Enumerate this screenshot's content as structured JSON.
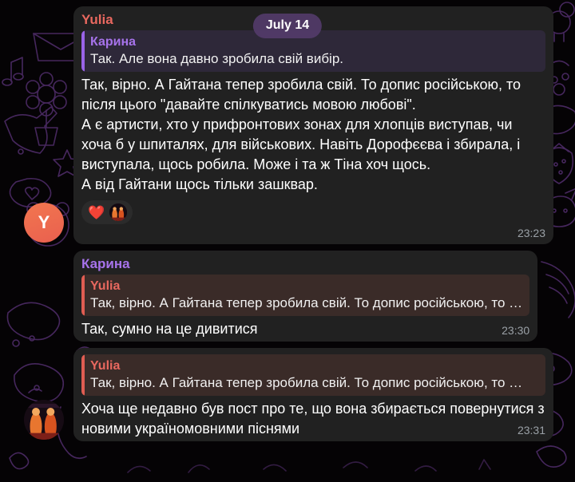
{
  "wallpaper": {
    "base_color": "#050305",
    "doodle_color": "#4a2a63"
  },
  "date_divider": {
    "label": "July 14"
  },
  "colors": {
    "bubble_bg": "#212121",
    "quote_purple_bg": "#2e2839",
    "quote_purple_bar": "#9a63e8",
    "quote_red_bg": "#3a2b28",
    "quote_red_bar": "#e05d52",
    "sender_red": "#e8685f",
    "sender_purple": "#a773eb",
    "time_gray": "#9aa0a6",
    "avatar_yulia": "#ef6a4f"
  },
  "messages": [
    {
      "id": "msg-1",
      "sender": "Yulia",
      "sender_color_class": "red",
      "avatar": {
        "type": "letter",
        "letter": "Y",
        "name": "avatar-yulia"
      },
      "quote": {
        "author": "Карина",
        "text": "Так. Але вона давно зробила свій вибір.",
        "style": "purple"
      },
      "body": "Так, вірно. А Гайтана тепер зробила свій. То допис російською, то після цього \"давайте спілкуватись мовою любові\".\nА є артисти, хто у прифронтових зонах для хлопців виступав, чи хоча б у шпиталях, для військових. Навіть Дорофєєва і збирала, і виступала, щось робила. Може і та ж Тіна хоч щось.\nА від Гайтани щось тільки зашквар.",
      "reactions": [
        {
          "emoji": "❤️",
          "name": "reaction-heart",
          "has_avatar": true
        }
      ],
      "time": "23:23"
    },
    {
      "id": "msg-2",
      "sender": "Карина",
      "sender_color_class": "purple",
      "avatar": null,
      "quote": {
        "author": "Yulia",
        "text": "Так, вірно. А Гайтана тепер зробила свій. То допис російською, то …",
        "style": "red"
      },
      "body": "Так, сумно на це дивитися",
      "reactions": [],
      "time": "23:30"
    },
    {
      "id": "msg-3",
      "sender": null,
      "sender_color_class": "purple",
      "avatar": {
        "type": "photo",
        "name": "avatar-karina"
      },
      "quote": {
        "author": "Yulia",
        "text": "Так, вірно. А Гайтана тепер зробила свій. То допис російською, то …",
        "style": "red"
      },
      "body": "Хоча ще недавно був пост про те, що вона збирається повернутися з новими україномовними піснями",
      "reactions": [],
      "time": "23:31"
    }
  ]
}
